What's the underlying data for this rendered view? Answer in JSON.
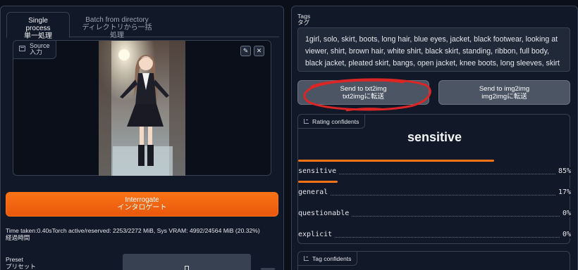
{
  "tabs": [
    {
      "label": "Single process",
      "sublabel": "単一処理"
    },
    {
      "label": "Batch from directory",
      "sublabel": "ディレクトリから一括処理"
    }
  ],
  "source": {
    "label": "Source",
    "sublabel": "入力",
    "edit_icon": "pencil-icon",
    "close_icon": "close-icon"
  },
  "interrogate": {
    "label": "Interrogate",
    "sublabel": "インタロゲート"
  },
  "time_info": {
    "line1": "Time taken:0.40sTorch active/reserved: 2253/2272 MiB, Sys VRAM: 4992/24564 MiB (20.32%)",
    "line2": "経過時間"
  },
  "preset": {
    "label": "Preset",
    "sublabel": "プリセット"
  },
  "tags": {
    "label": "Tags",
    "sublabel": "タグ",
    "value": "1girl, solo, skirt, boots, long hair, blue eyes, jacket, black footwear, looking at viewer, shirt, brown hair, white shirt, black skirt, standing, ribbon, full body, black jacket, pleated skirt, bangs, open jacket, knee boots, long sleeves, skirt hold, open clothes, school uniform, neck ribbon, indoors, bow, breasts, arch"
  },
  "buttons": {
    "txt2img": {
      "label": "Send to txt2img",
      "sublabel": "txt2imgに転送"
    },
    "img2img": {
      "label": "Send to img2img",
      "sublabel": "img2imgに転送"
    }
  },
  "rating": {
    "label": "Rating confidents",
    "top": "sensitive",
    "items": [
      {
        "name": "sensitive",
        "value": "85%",
        "fraction": 0.85
      },
      {
        "name": "general",
        "value": "17%",
        "fraction": 0.17
      },
      {
        "name": "questionable",
        "value": "0%",
        "fraction": 0
      },
      {
        "name": "explicit",
        "value": "0%",
        "fraction": 0
      }
    ]
  },
  "tag_confidents": {
    "label": "Tag confidents"
  },
  "colors": {
    "accent": "#f97316",
    "background": "#0b0f19",
    "panel": "#111827",
    "annotation": "#dc2626"
  }
}
